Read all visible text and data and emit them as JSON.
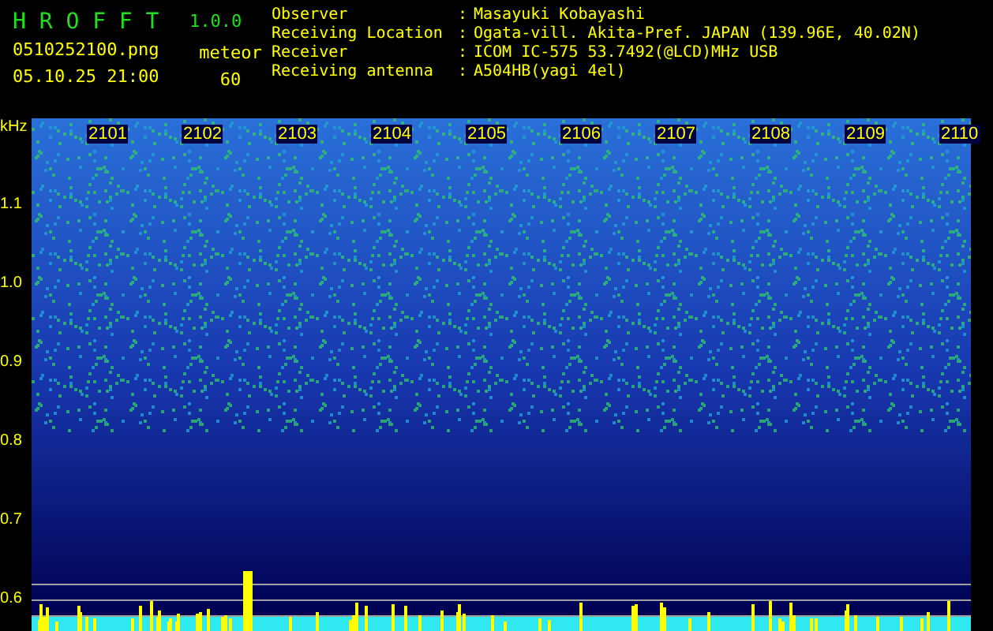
{
  "app": {
    "name": "H R O F F T",
    "version": "1.0.0"
  },
  "file_name": "0510252100.png",
  "timestamp": "05.10.25 21:00",
  "counter": {
    "label": "meteor",
    "value": "60"
  },
  "station_info": [
    {
      "label": "Observer",
      "separator": ":",
      "value": "Masayuki Kobayashi"
    },
    {
      "label": "Receiving Location",
      "separator": ":",
      "value": "Ogata-vill. Akita-Pref. JAPAN (139.96E, 40.02N)"
    },
    {
      "label": "Receiver",
      "separator": ":",
      "value": "ICOM IC-575 53.7492(@LCD)MHz USB"
    },
    {
      "label": "Receiving antenna",
      "separator": ":",
      "value": "A504HB(yagi 4el)"
    }
  ],
  "spectrogram": {
    "y_unit": "kHz",
    "y_ticks": [
      "1.1",
      "1.0",
      "0.9",
      "0.8",
      "0.7",
      "0.6"
    ],
    "time_labels": [
      "2101",
      "2102",
      "2103",
      "2104",
      "2105",
      "2106",
      "2107",
      "2108",
      "2109",
      "2110"
    ]
  }
}
